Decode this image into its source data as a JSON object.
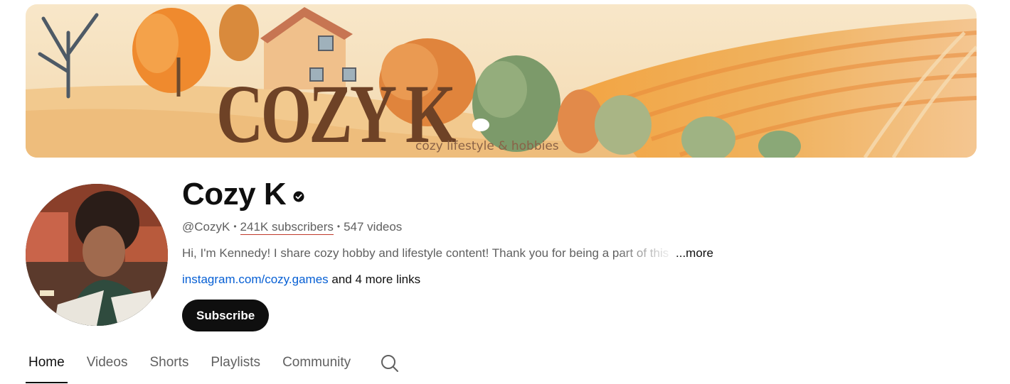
{
  "banner": {
    "title": "COZY K",
    "tagline": "cozy lifestyle & hobbies"
  },
  "channel": {
    "name": "Cozy K",
    "verified_icon": "verified-check-icon",
    "handle": "@CozyK",
    "subscribers": "241K subscribers",
    "videos": "547 videos",
    "separator": "•",
    "description": "Hi, I'm Kennedy! I share cozy hobby and lifestyle content! Thank you for being a part of this",
    "more_label": "...more",
    "link_text": "instagram.com/cozy.games",
    "more_links": " and 4 more links"
  },
  "subscribe_label": "Subscribe",
  "tabs": [
    {
      "label": "Home",
      "active": true
    },
    {
      "label": "Videos"
    },
    {
      "label": "Shorts"
    },
    {
      "label": "Playlists"
    },
    {
      "label": "Community"
    }
  ],
  "tab_search_icon": "search-icon",
  "colors": {
    "banner_bg": "#f6e3c4",
    "banner_title": "#6e4226",
    "link_blue": "#065fd4",
    "subscribe_bg": "#0f0f0f"
  }
}
